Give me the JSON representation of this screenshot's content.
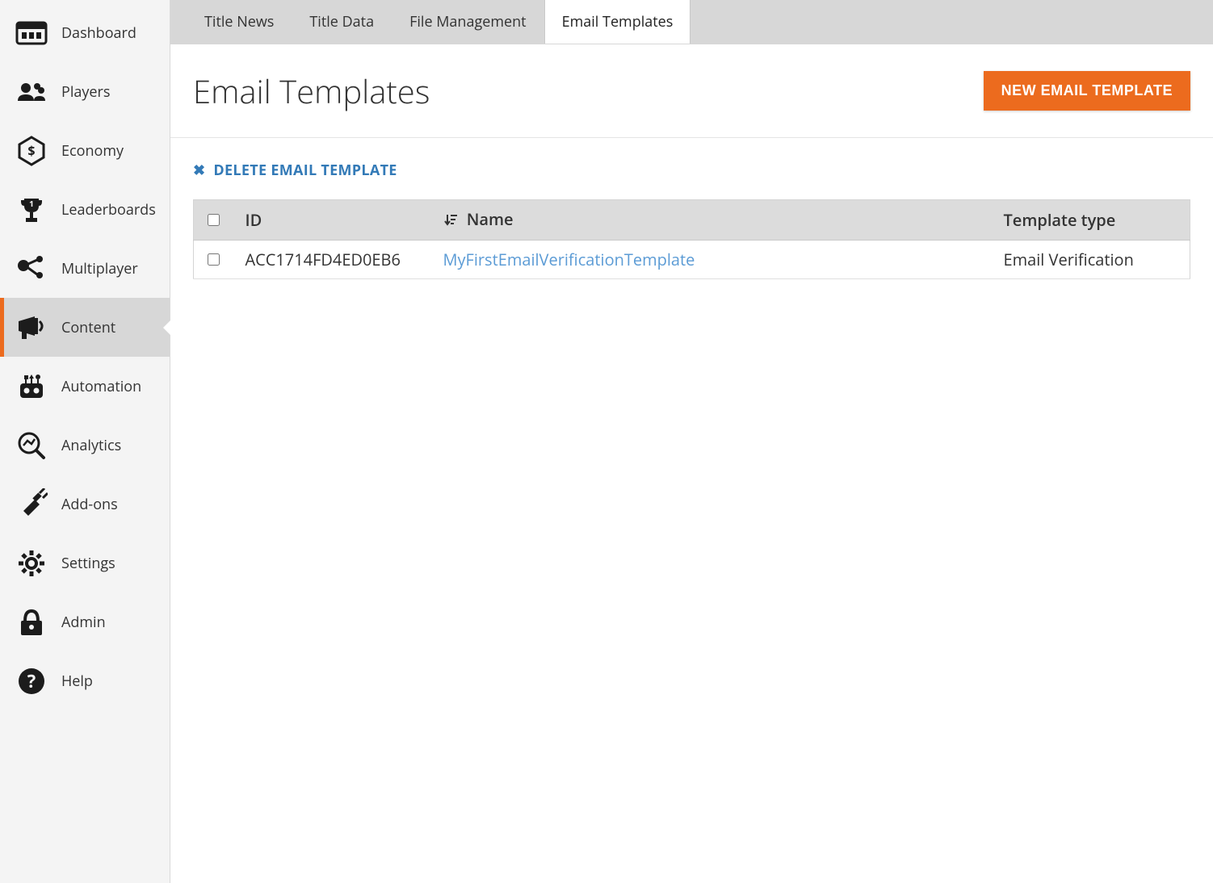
{
  "sidebar": {
    "items": [
      {
        "label": "Dashboard",
        "icon": "dashboard"
      },
      {
        "label": "Players",
        "icon": "players"
      },
      {
        "label": "Economy",
        "icon": "economy"
      },
      {
        "label": "Leaderboards",
        "icon": "leaderboards"
      },
      {
        "label": "Multiplayer",
        "icon": "multiplayer"
      },
      {
        "label": "Content",
        "icon": "content",
        "active": true
      },
      {
        "label": "Automation",
        "icon": "automation"
      },
      {
        "label": "Analytics",
        "icon": "analytics"
      },
      {
        "label": "Add-ons",
        "icon": "addons"
      },
      {
        "label": "Settings",
        "icon": "settings"
      },
      {
        "label": "Admin",
        "icon": "admin"
      },
      {
        "label": "Help",
        "icon": "help"
      }
    ]
  },
  "tabs": [
    {
      "label": "Title News"
    },
    {
      "label": "Title Data"
    },
    {
      "label": "File Management"
    },
    {
      "label": "Email Templates",
      "active": true
    }
  ],
  "page": {
    "title": "Email Templates",
    "new_button": "NEW EMAIL TEMPLATE",
    "delete_action": "DELETE EMAIL TEMPLATE"
  },
  "table": {
    "headers": {
      "id": "ID",
      "name": "Name",
      "type": "Template type"
    },
    "rows": [
      {
        "id": "ACC1714FD4ED0EB6",
        "name": "MyFirstEmailVerificationTemplate",
        "type": "Email Verification"
      }
    ]
  }
}
